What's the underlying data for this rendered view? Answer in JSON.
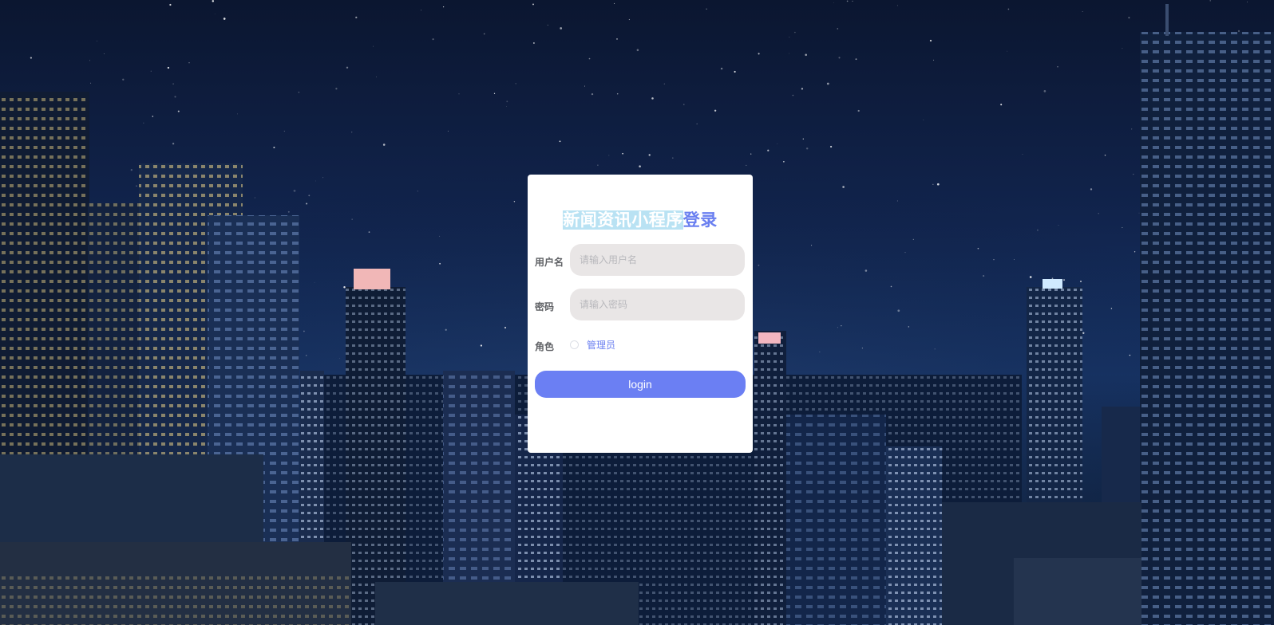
{
  "login": {
    "title_highlight": "新闻资讯小程序",
    "title_rest": "登录",
    "username_label": "用户名",
    "username_placeholder": "请输入用户名",
    "username_value": "",
    "password_label": "密码",
    "password_placeholder": "请输入密码",
    "password_value": "",
    "role_label": "角色",
    "role_options": [
      "管理员"
    ],
    "role_option_0": "管理员",
    "role_selected": false,
    "submit_label": "login"
  },
  "colors": {
    "accent": "#6b7ff3",
    "title_highlight_bg": "#b9e2f3",
    "field_bg": "#e9e6e6",
    "card_bg": "#ffffff",
    "sky_top": "#0b1630",
    "sky_mid": "#163365"
  },
  "background": {
    "icon": "night-city-skyline-image"
  }
}
